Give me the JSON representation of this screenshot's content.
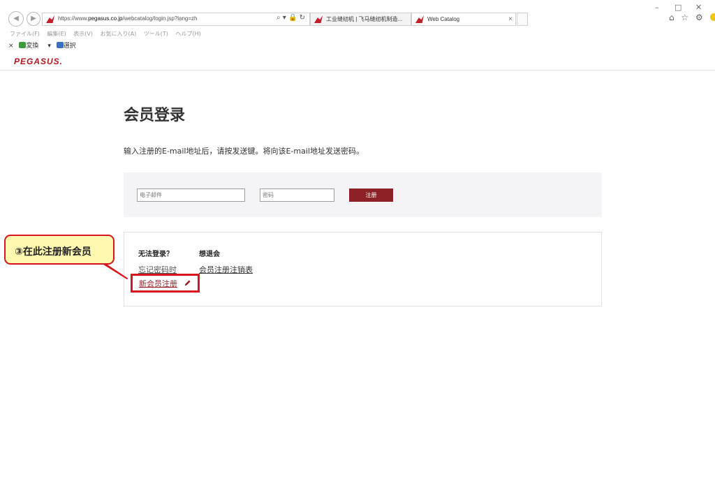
{
  "browser": {
    "url_prefix": "https://www.",
    "url_domain": "pegasus.co.jp",
    "url_path": "/webcatalog/login.jsp?lang=zh",
    "address_actions": "⌕ ▾ 🔒 ↻",
    "tabs": [
      {
        "title": "工业缝纫机 | 飞马缝纫机制造..."
      },
      {
        "title": "Web Catalog",
        "close": "×"
      }
    ],
    "menu": [
      "ファイル(F)",
      "編集(E)",
      "表示(V)",
      "お気に入り(A)",
      "ツール(T)",
      "ヘルプ(H)"
    ],
    "toolbar": {
      "close": "×",
      "convert": "変換",
      "dropdown": "▾",
      "select": "選択"
    },
    "window_controls": {
      "min": "–",
      "max": "□",
      "close": "✕"
    },
    "tool_icons": "⌂ ☆ ⚙"
  },
  "site": {
    "brand": "PEGASUS."
  },
  "login": {
    "title": "会员登录",
    "instruction": "输入注册的E-mail地址后，请按发送键。将向该E-mail地址发送密码。",
    "email_placeholder": "电子邮件",
    "password_placeholder": "密码",
    "register_button": "注册"
  },
  "help": {
    "cannot_login_heading": "无法登录？",
    "quit_heading": "想退会",
    "forgot_password": "忘记密码时",
    "cancel_registration": "会员注册注销表",
    "new_member": "新会员注册"
  },
  "callout": {
    "text": "③在此注册新会员"
  },
  "colors": {
    "brand_red": "#b3171f",
    "button": "#8c2126",
    "highlight": "#d7151e",
    "callout_bg": "#fff8b0"
  }
}
